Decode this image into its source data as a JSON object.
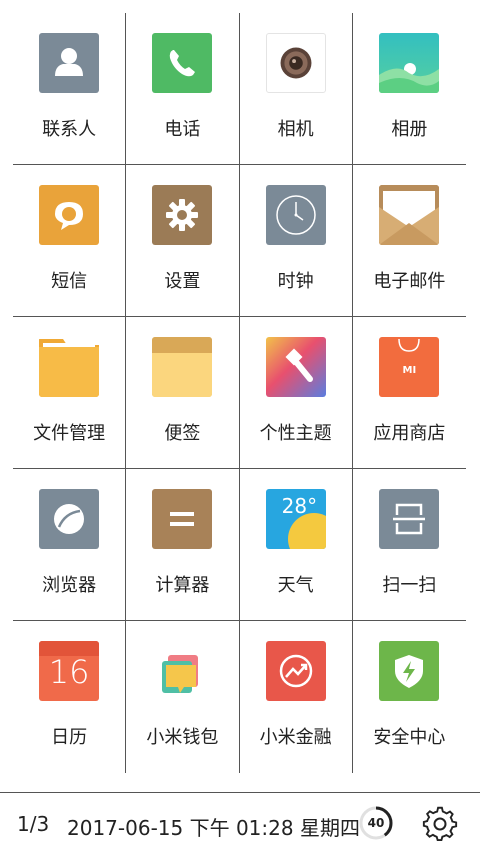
{
  "apps": [
    {
      "label": "联系人",
      "icon": "contacts-icon",
      "color": "#7b8a97"
    },
    {
      "label": "电话",
      "icon": "phone-icon",
      "color": "#4fba64"
    },
    {
      "label": "相机",
      "icon": "camera-icon",
      "color": "#ffffff"
    },
    {
      "label": "相册",
      "icon": "gallery-icon",
      "color": "#3cc2a5"
    },
    {
      "label": "短信",
      "icon": "message-icon",
      "color": "#e9a33a"
    },
    {
      "label": "设置",
      "icon": "settings-icon",
      "color": "#9b7b56"
    },
    {
      "label": "时钟",
      "icon": "clock-icon",
      "color": "#7b8a97"
    },
    {
      "label": "电子邮件",
      "icon": "email-icon",
      "color": "#d1a66a"
    },
    {
      "label": "文件管理",
      "icon": "folder-icon",
      "color": "#f5b84a"
    },
    {
      "label": "便签",
      "icon": "notes-icon",
      "color": "#f8d27a"
    },
    {
      "label": "个性主题",
      "icon": "themes-icon",
      "color": "#e85b6c"
    },
    {
      "label": "应用商店",
      "icon": "app-store-icon",
      "color": "#f26c3e"
    },
    {
      "label": "浏览器",
      "icon": "browser-icon",
      "color": "#7b8a97"
    },
    {
      "label": "计算器",
      "icon": "calculator-icon",
      "color": "#a88258"
    },
    {
      "label": "天气",
      "icon": "weather-icon",
      "color": "#27a6e0",
      "text": "28°"
    },
    {
      "label": "扫一扫",
      "icon": "scanner-icon",
      "color": "#7b8a97"
    },
    {
      "label": "日历",
      "icon": "calendar-icon",
      "color": "#f06a4a",
      "text": "16"
    },
    {
      "label": "小米钱包",
      "icon": "wallet-icon",
      "color": "#f5c64b"
    },
    {
      "label": "小米金融",
      "icon": "finance-icon",
      "color": "#e8574a"
    },
    {
      "label": "安全中心",
      "icon": "security-icon",
      "color": "#6db64a"
    }
  ],
  "app_store_badge": "MI",
  "status": {
    "page": "1/3",
    "datetime": "2017-06-15 下午 01:28 星期四",
    "battery": "40",
    "battery_level": 0.4
  }
}
